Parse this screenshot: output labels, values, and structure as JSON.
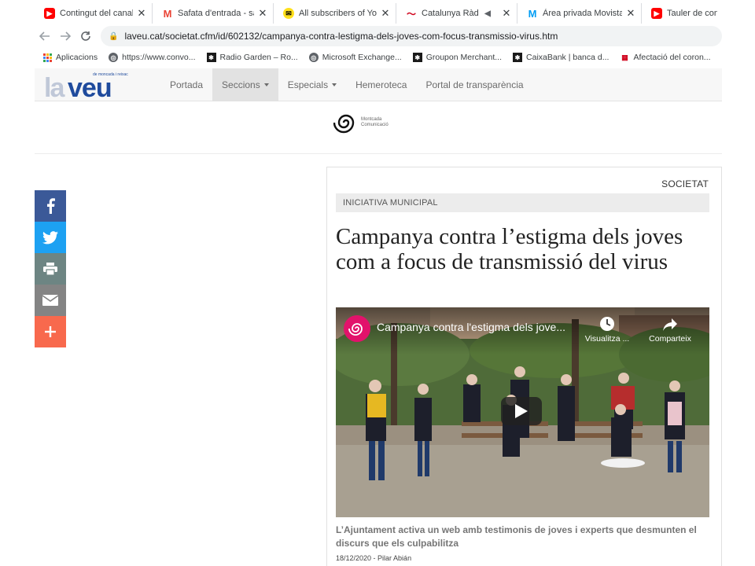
{
  "browser": {
    "tabs": [
      {
        "title": "Contingut del canal - You",
        "icon": "youtube-icon",
        "color": "#ff0000"
      },
      {
        "title": "Safata d'entrada - salat",
        "icon": "gmail-icon",
        "color": "#ea4335"
      },
      {
        "title": "All subscribers of Yoga",
        "icon": "mailchimp-icon",
        "color": "#ffe01b"
      },
      {
        "title": "Catalunya Ràdio en",
        "icon": "catradio-icon",
        "color": "#d0021b"
      },
      {
        "title": "Àrea privada Movistar",
        "icon": "movistar-icon",
        "color": "#019df4"
      },
      {
        "title": "Tauler de cont",
        "icon": "youtube-icon",
        "color": "#ff0000"
      }
    ],
    "url": "laveu.cat/societat.cfm/id/602132/campanya-contra-lestigma-dels-joves-com-focus-transmissio-virus.htm",
    "bookmarks": [
      {
        "label": "Aplicacions",
        "icon": "apps-grid-icon"
      },
      {
        "label": "https://www.convo...",
        "icon": "globe-icon"
      },
      {
        "label": "Radio Garden – Ro...",
        "icon": "caixabank-icon"
      },
      {
        "label": "Microsoft Exchange...",
        "icon": "globe-icon"
      },
      {
        "label": "Groupon Merchant...",
        "icon": "caixabank-icon"
      },
      {
        "label": "CaixaBank | banca d...",
        "icon": "caixabank-icon"
      },
      {
        "label": "Afectació del coron...",
        "icon": "gencat-icon"
      }
    ]
  },
  "site": {
    "logo_la": "la",
    "logo_veu": "veu",
    "logo_tagline": "de moncada i reixac",
    "menu": [
      {
        "label": "Portada",
        "dropdown": false
      },
      {
        "label": "Seccions",
        "dropdown": true
      },
      {
        "label": "Especials",
        "dropdown": true
      },
      {
        "label": "Hemeroteca",
        "dropdown": false
      },
      {
        "label": "Portal de transparència",
        "dropdown": false
      }
    ],
    "sponsor_line1": "Montcada",
    "sponsor_line2": "Comunicació"
  },
  "share": [
    {
      "network": "facebook",
      "color": "#3b5998"
    },
    {
      "network": "twitter",
      "color": "#1da1f2"
    },
    {
      "network": "print",
      "color": "#6d8583"
    },
    {
      "network": "email",
      "color": "#848484"
    },
    {
      "network": "more",
      "color": "#f8694d"
    }
  ],
  "article": {
    "section": "SOCIETAT",
    "kicker": "INICIATIVA MUNICIPAL",
    "headline": "Campanya contra l’estigma dels joves com a focus de transmissió del virus",
    "video": {
      "title": "Campanya contra l'estigma dels jove...",
      "watch_later": "Visualitza ...",
      "share": "Comparteix"
    },
    "lede": "L’Ajuntament activa un web amb testimonis de joves i experts que desmunten el discurs que els culpabilitza",
    "byline": "18/12/2020 - Pilar Abián"
  }
}
